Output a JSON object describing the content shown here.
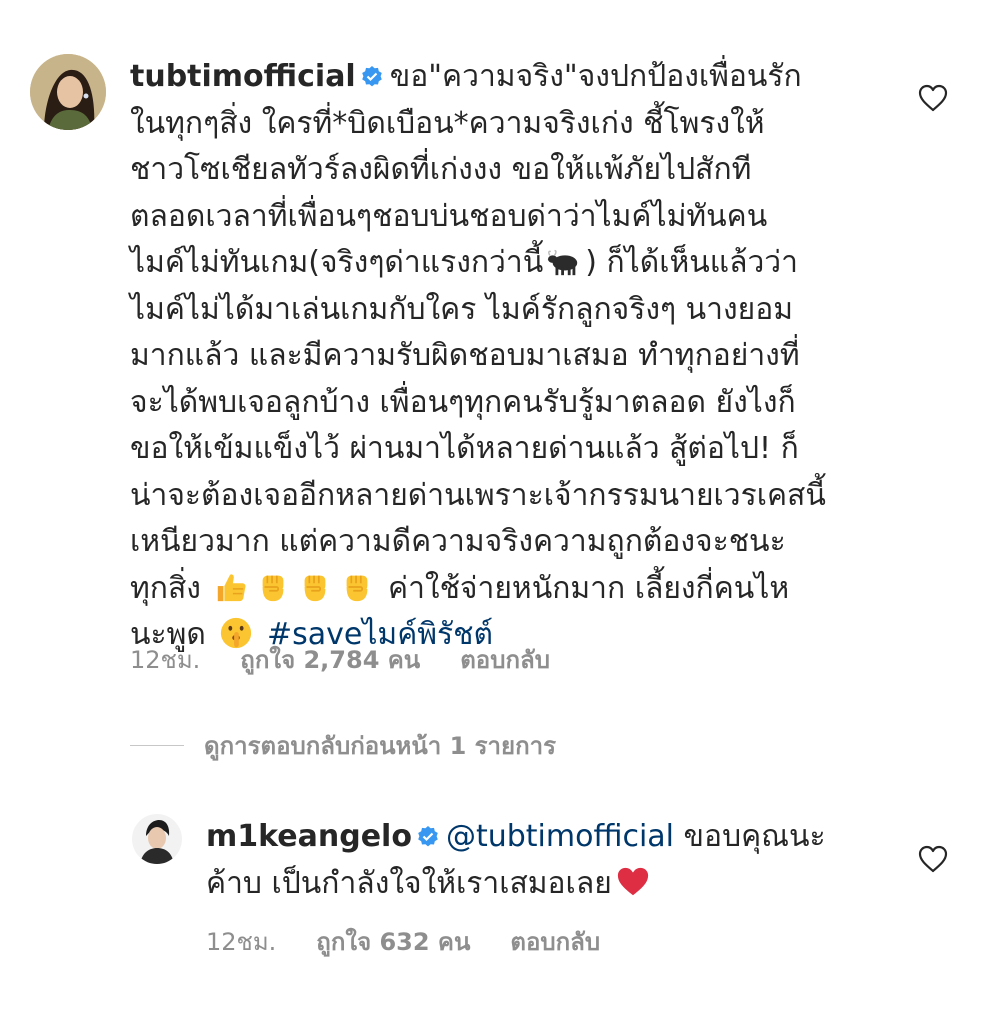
{
  "comment": {
    "username": "tubtimofficial",
    "lines": [
      "ขอ\"ความจริง\"จงปกป้องเพื่อนรัก",
      "ในทุกๆสิ่ง  ใครที่*บิดเบือน*ความจริงเก่ง ชี้โพรงให้",
      "ชาวโซเชียลทัวร์ลงผิดที่เก่งงง ขอให้แพ้ภัยไปสักที",
      "ตลอดเวลาที่เพื่อนๆชอบบ่นชอบด่าว่าไมค์ไม่ทันคน",
      "ไมค์ไม่ทันเกม(จริงๆด่าแรงกว่านี้",
      ") ก็ได้เห็นแล้วว่า",
      "ไมค์ไม่ได้มาเล่นเกมกับใคร ไมค์รักลูกจริงๆ นางยอม",
      "มากแล้ว และมีความรับผิดชอบมาเสมอ ทำทุกอย่างที่",
      "จะได้พบเจอลูกบ้าง เพื่อนๆทุกคนรับรู้มาตลอด ยังไงก็",
      "ขอให้เข้มแข็งไว้ ผ่านมาได้หลายด่านแล้ว สู้ต่อไป!  ก็",
      "น่าจะต้องเจออีกหลายด่านเพราะเจ้ากรรมนายเวรเคสนี้",
      "เหนียวมาก  แต่ความดีความจริงความถูกต้องจะชนะ",
      "ทุกสิ่ง",
      "ค่าใช้จ่ายหนักมาก เลี้ยงกี่คนไห",
      "นะพูด"
    ],
    "hashtag": "#saveไมค์พิรัชต์",
    "time": "12ชม.",
    "likes": "ถูกใจ 2,784 คน",
    "reply_label": "ตอบกลับ",
    "icons": {
      "verified": "verified-badge-icon",
      "bull": "ox-emoji-icon",
      "thumbs": "thumbs-up-emoji-icon",
      "fist": "raised-fist-emoji-icon",
      "shush": "shushing-face-emoji-icon",
      "heart": "heart-outline-icon"
    }
  },
  "view_replies": "ดูการตอบกลับก่อนหน้า 1 รายการ",
  "reply": {
    "username": "m1keangelo",
    "mention": "@tubtimofficial",
    "line1_text": "ขอบคุณนะ",
    "line2_text": "ค้าบ เป็นกำลังใจให้เราเสมอเลย",
    "time": "12ชม.",
    "likes": "ถูกใจ 632 คน",
    "reply_label": "ตอบกลับ",
    "icons": {
      "verified": "verified-badge-icon",
      "heart_emoji": "red-heart-emoji-icon",
      "heart": "heart-outline-icon"
    }
  },
  "colors": {
    "text": "#262626",
    "meta": "#8e8e8e",
    "link": "#00376b",
    "verified": "#3897f0"
  }
}
